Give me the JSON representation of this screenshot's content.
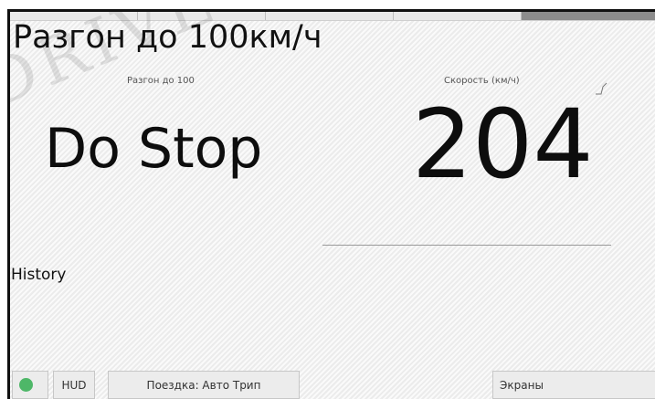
{
  "window": {
    "title": "Разгон до 100км/ч",
    "watermark": "DRIVE"
  },
  "left_panel": {
    "label": "Разгон до 100",
    "status": "Do Stop"
  },
  "right_panel": {
    "label": "Скорость (км/ч)",
    "speed_value": "204"
  },
  "history": {
    "label": "History"
  },
  "status_bar": {
    "indicator_color": "#4eb768",
    "hud_label": "HUD",
    "trip_label": "Поездка: Авто Трип",
    "screens_label": "Экраны"
  }
}
